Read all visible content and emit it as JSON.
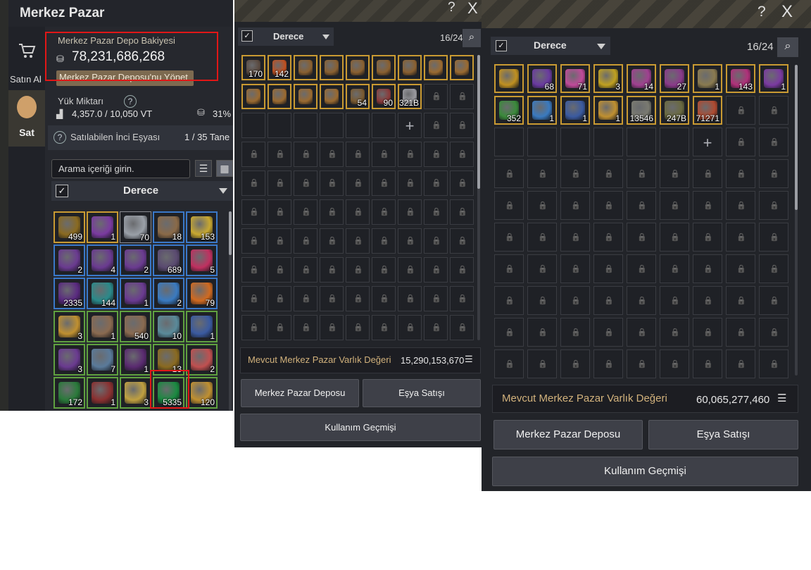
{
  "panel_left": {
    "title": "Merkez Pazar",
    "nav": {
      "buy_label": "Satın Al",
      "buy_icon": "cart-icon",
      "sell_label": "Sat",
      "sell_icon": "money-bag-icon"
    },
    "balance": {
      "title": "Merkez Pazar Depo Bakiyesi",
      "value": "78,231,686,268",
      "manage_button": "Merkez Pazar Deposu'nu Yönet"
    },
    "load": {
      "title": "Yük Miktarı",
      "value": "4,357.0 / 10,050 VT",
      "percent": "31%"
    },
    "pearl": {
      "label": "Satılabilen İnci Eşyası",
      "count": "1 / 35 Tane"
    },
    "search_placeholder": "Arama içeriği girin.",
    "sort_label": "Derece",
    "items": [
      {
        "count": "499",
        "q": "gold",
        "color": "#8a6a20"
      },
      {
        "count": "1",
        "q": "gold",
        "color": "#7a3aa0"
      },
      {
        "count": "70",
        "q": "white",
        "color": "#9aa0a8"
      },
      {
        "count": "18",
        "q": "blue",
        "color": "#8a6a48"
      },
      {
        "count": "153",
        "q": "blue",
        "color": "#c8a830"
      },
      {
        "count": "2",
        "q": "blue",
        "color": "#6a3a90"
      },
      {
        "count": "4",
        "q": "blue",
        "color": "#6a3a90"
      },
      {
        "count": "2",
        "q": "blue",
        "color": "#6a3a90"
      },
      {
        "count": "689",
        "q": "blue",
        "color": "#5a4a70"
      },
      {
        "count": "5",
        "q": "blue",
        "color": "#c03060"
      },
      {
        "count": "2335",
        "q": "blue",
        "color": "#5a2a80"
      },
      {
        "count": "144",
        "q": "blue",
        "color": "#2a8a8a"
      },
      {
        "count": "1",
        "q": "blue",
        "color": "#6a3a90"
      },
      {
        "count": "2",
        "q": "blue",
        "color": "#3a7ac0"
      },
      {
        "count": "79",
        "q": "blue",
        "color": "#d06a20"
      },
      {
        "count": "3",
        "q": "green",
        "color": "#c09030"
      },
      {
        "count": "1",
        "q": "green",
        "color": "#8a6a50"
      },
      {
        "count": "540",
        "q": "green",
        "color": "#8a6a50"
      },
      {
        "count": "10",
        "q": "green",
        "color": "#5a8a9a"
      },
      {
        "count": "1",
        "q": "green",
        "color": "#3a5aa0"
      },
      {
        "count": "3",
        "q": "green",
        "color": "#6a3a90"
      },
      {
        "count": "7",
        "q": "green",
        "color": "#5a7a9a"
      },
      {
        "count": "1",
        "q": "green",
        "color": "#5a2a70"
      },
      {
        "count": "13",
        "q": "green",
        "color": "#8a6a20"
      },
      {
        "count": "2",
        "q": "green",
        "color": "#c05050"
      },
      {
        "count": "172",
        "q": "green",
        "color": "#2a7a3a"
      },
      {
        "count": "1",
        "q": "green",
        "color": "#8a3030"
      },
      {
        "count": "3",
        "q": "green",
        "color": "#c0a040"
      },
      {
        "count": "5335",
        "q": "green",
        "color": "#1a8a40"
      },
      {
        "count": "120",
        "q": "green",
        "color": "#c09030"
      }
    ]
  },
  "panel_mid": {
    "help_icon": "?",
    "close_icon": "X",
    "sort_label": "Derece",
    "slot_count": "16/24",
    "items": [
      {
        "count": "170",
        "color": "#5a4a40"
      },
      {
        "count": "142",
        "color": "#c05020"
      },
      {
        "count": "",
        "color": "#8a6030"
      },
      {
        "count": "",
        "color": "#8a6030"
      },
      {
        "count": "",
        "color": "#8a6030"
      },
      {
        "count": "",
        "color": "#8a6030"
      },
      {
        "count": "",
        "color": "#8a6030"
      },
      {
        "count": "",
        "color": "#9a6a30"
      },
      {
        "count": "",
        "color": "#9a6a30"
      },
      {
        "count": "",
        "color": "#9a6a30"
      },
      {
        "count": "",
        "color": "#9a6a30"
      },
      {
        "count": "",
        "color": "#9a6a30"
      },
      {
        "count": "",
        "color": "#9a6a30"
      },
      {
        "count": "54",
        "color": "#7a5a30"
      },
      {
        "count": "90",
        "color": "#8a3a3a"
      },
      {
        "count": "321B",
        "color": "#9a9aa0"
      }
    ],
    "asset_label": "Mevcut Merkez Pazar Varlık Değeri",
    "asset_value": "15,290,153,670",
    "buttons": {
      "depot": "Merkez Pazar Deposu",
      "sell": "Eşya Satışı",
      "history": "Kullanım Geçmişi"
    }
  },
  "panel_right": {
    "help_icon": "?",
    "close_icon": "X",
    "sort_label": "Derece",
    "slot_count": "16/24",
    "items": [
      {
        "count": "",
        "color": "#c09020"
      },
      {
        "count": "68",
        "color": "#6a3aa0"
      },
      {
        "count": "71",
        "color": "#c04a9a"
      },
      {
        "count": "3",
        "color": "#c0a020"
      },
      {
        "count": "14",
        "color": "#a04090"
      },
      {
        "count": "27",
        "color": "#8a3a8a"
      },
      {
        "count": "1",
        "color": "#8a7a50"
      },
      {
        "count": "143",
        "color": "#b0307a"
      },
      {
        "count": "1",
        "color": "#7a3aa0"
      },
      {
        "count": "352",
        "color": "#3a8a3a"
      },
      {
        "count": "1",
        "color": "#3a7ac0"
      },
      {
        "count": "1",
        "color": "#3a5aa0"
      },
      {
        "count": "1",
        "color": "#c09030"
      },
      {
        "count": "13546",
        "color": "#7a7a70"
      },
      {
        "count": "247B",
        "color": "#6a6a40"
      },
      {
        "count": "71271",
        "color": "#b04a30"
      }
    ],
    "asset_label": "Mevcut Merkez Pazar Varlık Değeri",
    "asset_value": "60,065,277,460",
    "buttons": {
      "depot": "Merkez Pazar Deposu",
      "sell": "Eşya Satışı",
      "history": "Kullanım Geçmişi"
    }
  }
}
